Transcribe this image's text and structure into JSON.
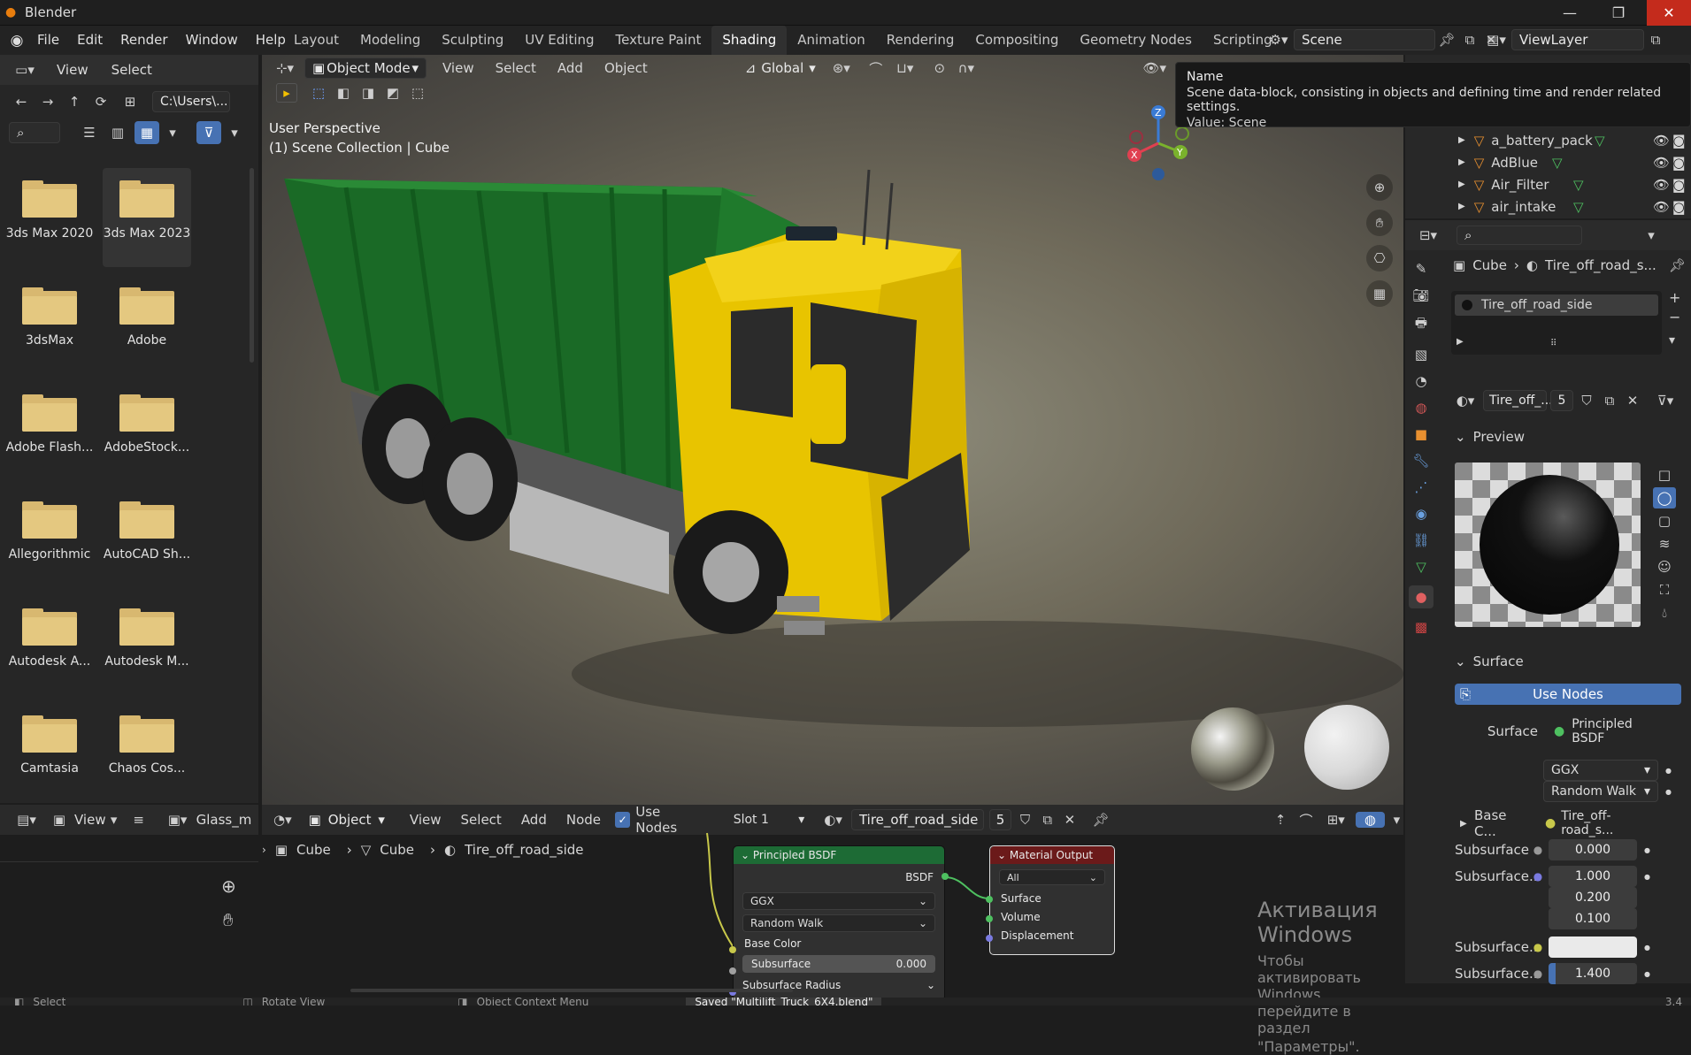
{
  "app": {
    "title": "Blender"
  },
  "menu": [
    "File",
    "Edit",
    "Render",
    "Window",
    "Help"
  ],
  "workspaces": [
    "Layout",
    "Modeling",
    "Sculpting",
    "UV Editing",
    "Texture Paint",
    "Shading",
    "Animation",
    "Rendering",
    "Compositing",
    "Geometry Nodes",
    "Scripting"
  ],
  "active_workspace": "Shading",
  "scene_field": "Scene",
  "viewlayer_field": "ViewLayer",
  "tooltip": {
    "title": "Name",
    "desc": "Scene data-block, consisting in objects and defining time and render related settings.",
    "value": "Value: Scene"
  },
  "filebrowser": {
    "menu": [
      "View",
      "Select"
    ],
    "path": "C:\\Users\\...",
    "folders": [
      "3ds Max 2020",
      "3ds Max 2023",
      "3dsMax",
      "Adobe",
      "Adobe Flash...",
      "AdobeStock...",
      "Allegorithmic",
      "AutoCAD Sh...",
      "Autodesk A...",
      "Autodesk M...",
      "Camtasia",
      "Chaos Cos..."
    ]
  },
  "viewport": {
    "mode": "Object Mode",
    "menu": [
      "View",
      "Select",
      "Add",
      "Object"
    ],
    "transform": "Global",
    "overlay_line1": "User Perspective",
    "overlay_line2": "(1) Scene Collection | Cube",
    "gizmo": {
      "x": "X",
      "y": "Y",
      "z": "Z"
    }
  },
  "outliner": {
    "items": [
      "a_battery_pack",
      "AdBlue",
      "Air_Filter",
      "air_intake"
    ]
  },
  "properties": {
    "breadcrumb_obj": "Cube",
    "breadcrumb_mat": "Tire_off_road_s...",
    "slot_material": "Tire_off_road_side",
    "material_field": "Tire_off_...",
    "users": "5",
    "preview_label": "Preview",
    "surface_label": "Surface",
    "use_nodes": "Use Nodes",
    "surface_key": "Surface",
    "surface_val": "Principled BSDF",
    "dist": "GGX",
    "sss_method": "Random Walk",
    "base_color_key": "Base C...",
    "base_color_val": "Tire_off-road_s...",
    "subsurface_key": "Subsurface",
    "subsurface_val": "0.000",
    "sss_radius_key": "Subsurface...",
    "sss_radius": [
      "1.000",
      "0.200",
      "0.100"
    ],
    "sss_color_key": "Subsurface...",
    "sss_ior_key": "Subsurface...",
    "sss_ior": "1.400"
  },
  "imageeditor": {
    "view": "View",
    "image": "Glass_m"
  },
  "nodeeditor": {
    "object": "Object",
    "menu": [
      "View",
      "Select",
      "Add",
      "Node"
    ],
    "use_nodes": "Use Nodes",
    "slot": "Slot 1",
    "material": "Tire_off_road_side",
    "users": "5",
    "breadcrumb": [
      "Cube",
      "Cube",
      "Tire_off_road_side"
    ],
    "bsdf": {
      "title": "Principled BSDF",
      "out": "BSDF",
      "dist": "GGX",
      "sss": "Random Walk",
      "base": "Base Color",
      "subsurface": "Subsurface",
      "subsurface_val": "0.000",
      "radius": "Subsurface Radius"
    },
    "output": {
      "title": "Material Output",
      "target": "All",
      "surface": "Surface",
      "volume": "Volume",
      "displacement": "Displacement"
    }
  },
  "watermark": {
    "line1": "Активация Windows",
    "line2": "Чтобы активировать Windows, перейдите в раздел",
    "line3": "\"Параметры\"."
  },
  "status": {
    "select": "Select",
    "rotate": "Rotate View",
    "context": "Object Context Menu",
    "saved": "Saved \"Multilift_Truck_6X4.blend\"",
    "version": "3.4"
  },
  "colors": {
    "accent": "#4772b3",
    "truck_yellow": "#e8c400",
    "container_green": "#1f7a2c",
    "node_green": "#1d6b35",
    "node_red": "#6b1a1a"
  }
}
